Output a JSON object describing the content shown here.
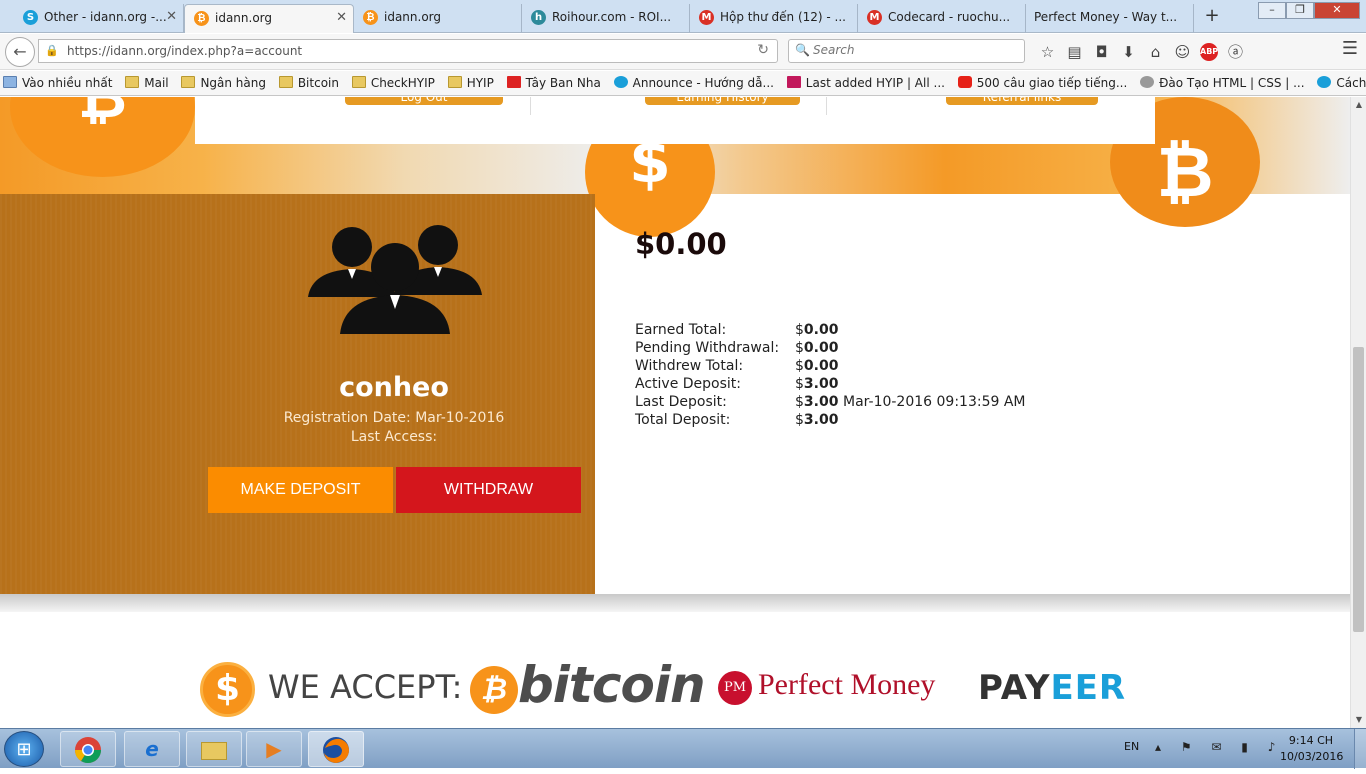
{
  "browser": {
    "tabs": [
      {
        "label": "Other - idann.org -...",
        "icon_color": "#1a9fd9",
        "icon_glyph": "S"
      },
      {
        "label": "idann.org",
        "icon_color": "#f7931a",
        "icon_glyph": "B",
        "active": true
      },
      {
        "label": "idann.org",
        "icon_color": "#f7931a",
        "icon_glyph": "B"
      },
      {
        "label": "Roihour.com - ROI...",
        "icon_color": "#2d8a9a",
        "icon_glyph": "h"
      },
      {
        "label": "Hộp thư đến (12) - ...",
        "icon_color": "#d93025",
        "icon_glyph": "M"
      },
      {
        "label": "Codecard - ruochu...",
        "icon_color": "#d93025",
        "icon_glyph": "M"
      },
      {
        "label": "Perfect Money - Way t...",
        "icon_color": "",
        "icon_glyph": ""
      }
    ],
    "new_tab": "+",
    "url": "https://idann.org/index.php?a=account",
    "search_placeholder": "Search",
    "bookmarks": [
      {
        "label": "Vào nhiều nhất",
        "icon": "most-visited-icon"
      },
      {
        "label": "Mail",
        "icon": "folder-icon"
      },
      {
        "label": "Ngân hàng",
        "icon": "folder-icon"
      },
      {
        "label": "Bitcoin",
        "icon": "folder-icon"
      },
      {
        "label": "CheckHYIP",
        "icon": "folder-icon"
      },
      {
        "label": "HYIP",
        "icon": "folder-icon"
      },
      {
        "label": "Tây Ban Nha",
        "icon": "tbn-icon"
      },
      {
        "label": "Announce - Hướng dẫ...",
        "icon": "s-icon"
      },
      {
        "label": "Last added HYIP | All ...",
        "icon": "a-icon"
      },
      {
        "label": "500 câu giao tiếp tiếng...",
        "icon": "youtube-icon"
      },
      {
        "label": "Đào Tạo HTML | CSS | ...",
        "icon": "globe-icon"
      },
      {
        "label": "Cách chơi CPM không...",
        "icon": "s-icon"
      }
    ]
  },
  "header": {
    "buttons": [
      "Log Out",
      "Earning History",
      "Referral links"
    ]
  },
  "profile": {
    "username": "conheo",
    "registration": "Registration Date: Mar-10-2016",
    "last_access": "Last Access:",
    "deposit_label": "MAKE DEPOSIT",
    "withdraw_label": "WITHDRAW"
  },
  "account": {
    "balance": "$0.00",
    "stats": [
      {
        "label": "Earned Total:",
        "currency": "$",
        "value": "0.00",
        "extra": ""
      },
      {
        "label": "Pending Withdrawal:",
        "currency": "$",
        "value": "0.00",
        "extra": ""
      },
      {
        "label": "Withdrew Total:",
        "currency": "$",
        "value": "0.00",
        "extra": ""
      },
      {
        "label": "Active Deposit:",
        "currency": "$",
        "value": "3.00",
        "extra": ""
      },
      {
        "label": "Last Deposit:",
        "currency": "$",
        "value": "3.00",
        "extra": "Mar-10-2016 09:13:59 AM"
      },
      {
        "label": "Total Deposit:",
        "currency": "$",
        "value": "3.00",
        "extra": ""
      }
    ]
  },
  "footer": {
    "we_accept": "WE ACCEPT:",
    "bitcoin": "bitcoin",
    "pm_badge": "PM",
    "perfect_money": "Perfect Money",
    "payeer_pay": "PAY",
    "payeer_eer": "EER"
  },
  "taskbar": {
    "lang": "EN",
    "time": "9:14 CH",
    "date": "10/03/2016"
  },
  "colors": {
    "profile_bg": "#b7711a",
    "deposit_btn": "#fb8c00",
    "withdraw_btn": "#d4161c",
    "bitcoin_orange": "#f7931a"
  }
}
